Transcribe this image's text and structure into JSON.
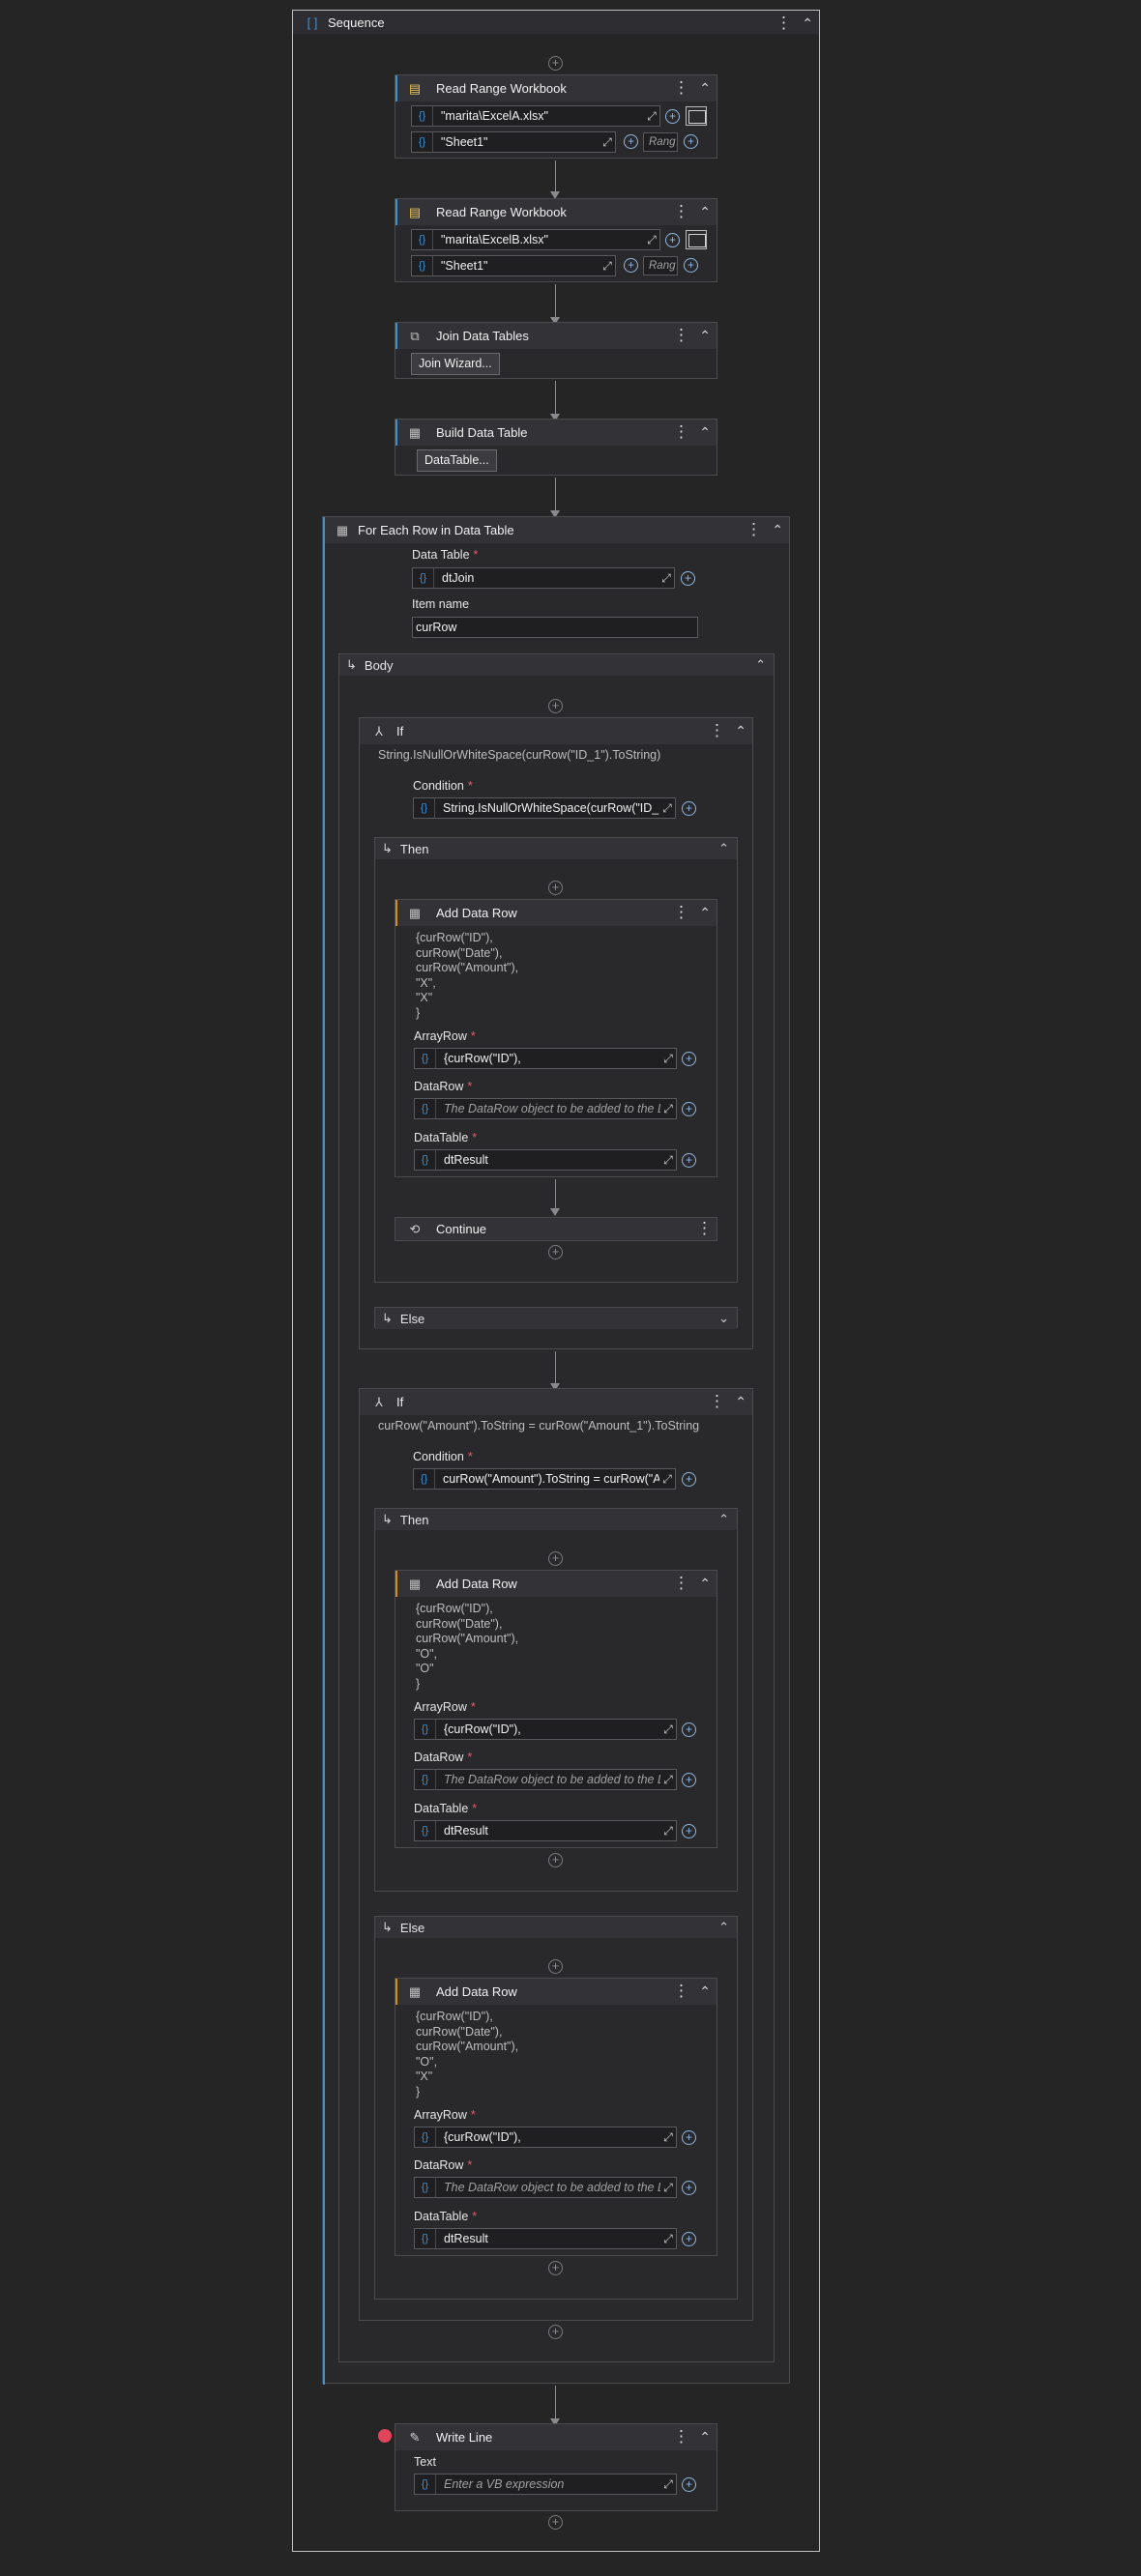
{
  "sequence": {
    "title": "Sequence"
  },
  "read1": {
    "title": "Read Range Workbook",
    "path": "\"marita\\ExcelA.xlsx\"",
    "sheet": "\"Sheet1\"",
    "range_ph": "Rang"
  },
  "read2": {
    "title": "Read Range Workbook",
    "path": "\"marita\\ExcelB.xlsx\"",
    "sheet": "\"Sheet1\"",
    "range_ph": "Rang"
  },
  "join": {
    "title": "Join Data Tables",
    "button": "Join Wizard..."
  },
  "build": {
    "title": "Build Data Table",
    "button": "DataTable..."
  },
  "foreach": {
    "title": "For Each Row in Data Table",
    "data_table_label": "Data Table",
    "data_table_value": "dtJoin",
    "item_label": "Item name",
    "item_value": "curRow",
    "body_label": "Body"
  },
  "if1": {
    "title": "If",
    "summary": "String.IsNullOrWhiteSpace(curRow(\"ID_1\").ToString)",
    "condition_label": "Condition",
    "condition_value": "String.IsNullOrWhiteSpace(curRow(\"ID_1\"",
    "then_label": "Then",
    "else_label": "Else",
    "add": {
      "title": "Add Data Row",
      "expr": "{curRow(\"ID\"),\ncurRow(\"Date\"),\ncurRow(\"Amount\"),\n\"X\",\n\"X\"\n}",
      "array_label": "ArrayRow",
      "array_value": "{curRow(\"ID\"),",
      "datarow_label": "DataRow",
      "datarow_ph": "The DataRow object to be added to the Da",
      "datatable_label": "DataTable",
      "datatable_value": "dtResult"
    },
    "continue": {
      "title": "Continue"
    }
  },
  "if2": {
    "title": "If",
    "summary": "curRow(\"Amount\").ToString = curRow(\"Amount_1\").ToString",
    "condition_label": "Condition",
    "condition_value": "curRow(\"Amount\").ToString = curRow(\"A",
    "then_label": "Then",
    "else_label": "Else",
    "add_then": {
      "title": "Add Data Row",
      "expr": "{curRow(\"ID\"),\ncurRow(\"Date\"),\ncurRow(\"Amount\"),\n\"O\",\n\"O\"\n}",
      "array_label": "ArrayRow",
      "array_value": "{curRow(\"ID\"),",
      "datarow_label": "DataRow",
      "datarow_ph": "The DataRow object to be added to the Da",
      "datatable_label": "DataTable",
      "datatable_value": "dtResult"
    },
    "add_else": {
      "title": "Add Data Row",
      "expr": "{curRow(\"ID\"),\ncurRow(\"Date\"),\ncurRow(\"Amount\"),\n\"O\",\n\"X\"\n}",
      "array_label": "ArrayRow",
      "array_value": "{curRow(\"ID\"),",
      "datarow_label": "DataRow",
      "datarow_ph": "The DataRow object to be added to the Da",
      "datatable_label": "DataTable",
      "datatable_value": "dtResult"
    }
  },
  "writeline": {
    "title": "Write Line",
    "text_label": "Text",
    "text_ph": "Enter a VB expression"
  },
  "icons": {
    "sequence": "sequence-brackets-icon",
    "excel": "excel-icon",
    "join": "join-icon",
    "table": "table-icon",
    "foreach": "foreach-icon",
    "if": "if-branch-icon",
    "continue": "continue-icon",
    "writeline": "write-line-icon"
  },
  "colors": {
    "accent_blue": "#3f8fd6",
    "accent_orange": "#d88a1a",
    "breakpoint": "#e0455a",
    "background": "#252526"
  }
}
